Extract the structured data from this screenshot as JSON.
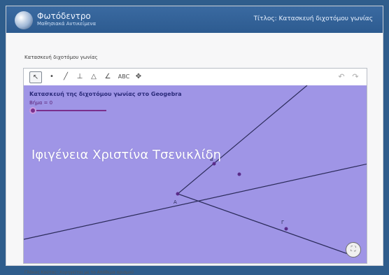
{
  "header": {
    "brand": "Φωτόδεντρο",
    "brand_subtitle": "Μαθησιακά Αντικείμενα",
    "title": "Τίτλος: Κατασκευή διχοτόμου γωνίας"
  },
  "page": {
    "heading": "Κατασκευή διχοτόμου γωνίας"
  },
  "applet": {
    "title": "Κατασκευή της διχοτόμου γωνίας στο Geogebra",
    "slider_label": "Βήμα = 0",
    "toolbar": {
      "tools": [
        "select",
        "point",
        "line",
        "perpendicular",
        "polygon",
        "angle",
        "text",
        "move"
      ],
      "text_tool_label": "ABC"
    },
    "points": [
      {
        "label": "A"
      },
      {
        "label": "B"
      },
      {
        "label": "Γ"
      }
    ]
  },
  "watermark": "Ιφιγένεια Χριστίνα Τσενικλίδη",
  "footer": {
    "left_text": "Γλάκας Κούτας: Χορηγείται με το Απόθεμα ορισμού",
    "link_text": "Πληροφορίες"
  },
  "colors": {
    "header_blue": "#2d5b90",
    "graph_bg": "#9f95e6",
    "line_dark": "#2b2b5a",
    "point_purple": "#5a2c8a"
  }
}
